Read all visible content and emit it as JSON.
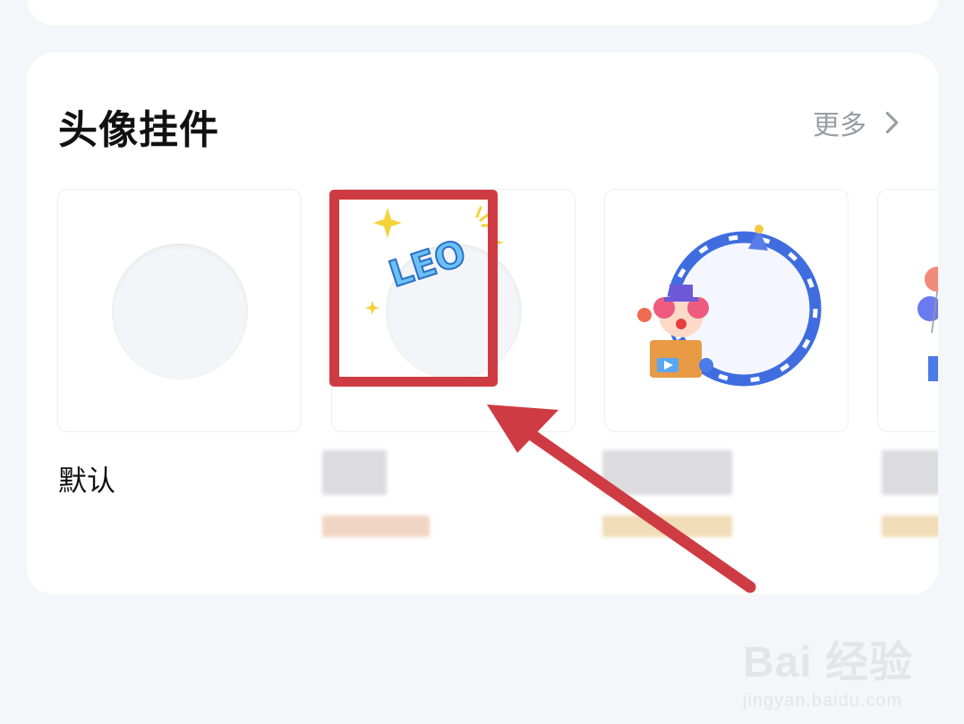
{
  "section": {
    "title": "头像挂件",
    "more_label": "更多"
  },
  "items": [
    {
      "label": "默认"
    },
    {
      "sticker_text": "LEO"
    }
  ],
  "colors": {
    "highlight": "#cf3b43",
    "frame_blue": "#3f6de0"
  },
  "watermark": {
    "logo": "Bai  经验",
    "url": "jingyan.baidu.com"
  }
}
